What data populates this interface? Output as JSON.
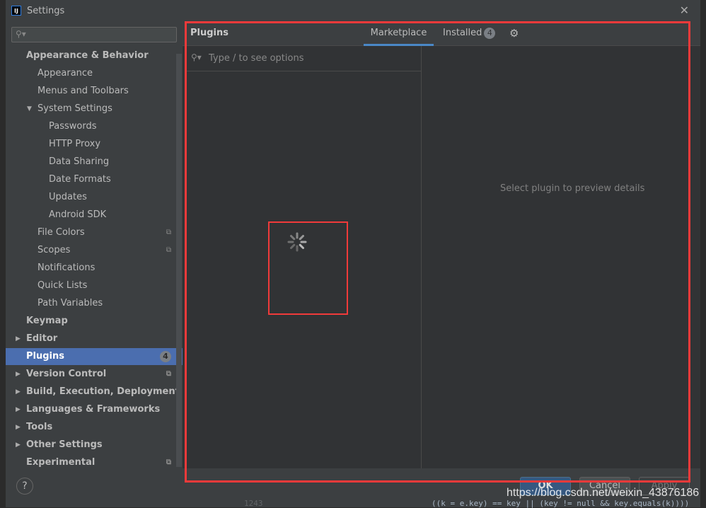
{
  "window": {
    "title": "Settings",
    "close_icon": "close-icon",
    "logo": "IJ"
  },
  "sidebar": {
    "search_placeholder": "",
    "items": [
      {
        "label": "Appearance & Behavior",
        "bold": true,
        "level": 0,
        "arrow": ""
      },
      {
        "label": "Appearance",
        "level": 1
      },
      {
        "label": "Menus and Toolbars",
        "level": 1
      },
      {
        "label": "System Settings",
        "level": 1,
        "arrow": "down"
      },
      {
        "label": "Passwords",
        "level": 2
      },
      {
        "label": "HTTP Proxy",
        "level": 2
      },
      {
        "label": "Data Sharing",
        "level": 2
      },
      {
        "label": "Date Formats",
        "level": 2
      },
      {
        "label": "Updates",
        "level": 2
      },
      {
        "label": "Android SDK",
        "level": 2
      },
      {
        "label": "File Colors",
        "level": 1,
        "copy": true
      },
      {
        "label": "Scopes",
        "level": 1,
        "copy": true
      },
      {
        "label": "Notifications",
        "level": 1
      },
      {
        "label": "Quick Lists",
        "level": 1
      },
      {
        "label": "Path Variables",
        "level": 1
      },
      {
        "label": "Keymap",
        "bold": true,
        "level": 0
      },
      {
        "label": "Editor",
        "bold": true,
        "level": 0,
        "arrow": "right"
      },
      {
        "label": "Plugins",
        "bold": true,
        "level": 0,
        "selected": true,
        "badge": "4"
      },
      {
        "label": "Version Control",
        "bold": true,
        "level": 0,
        "arrow": "right",
        "copy": true
      },
      {
        "label": "Build, Execution, Deployment",
        "bold": true,
        "level": 0,
        "arrow": "right"
      },
      {
        "label": "Languages & Frameworks",
        "bold": true,
        "level": 0,
        "arrow": "right"
      },
      {
        "label": "Tools",
        "bold": true,
        "level": 0,
        "arrow": "right"
      },
      {
        "label": "Other Settings",
        "bold": true,
        "level": 0,
        "arrow": "right"
      },
      {
        "label": "Experimental",
        "bold": true,
        "level": 0,
        "copy": true
      }
    ]
  },
  "main": {
    "title": "Plugins",
    "tabs": [
      {
        "label": "Marketplace",
        "active": true
      },
      {
        "label": "Installed",
        "badge": "4"
      }
    ],
    "settings_icon": "gear-icon",
    "search_placeholder": "Type / to see options",
    "detail_placeholder": "Select plugin to preview details",
    "loading": true
  },
  "footer": {
    "help": "?",
    "ok": "OK",
    "cancel": "Cancel",
    "apply": "Apply"
  },
  "background": {
    "line_number": "1243",
    "code": "((k = e.key) == key || (key != null && key.equals(k))))"
  },
  "watermark": "https://blog.csdn.net/weixin_43876186",
  "colors": {
    "selection": "#4b6eaf",
    "tab_underline": "#4a88c7",
    "highlight_box": "#f03a3a"
  }
}
